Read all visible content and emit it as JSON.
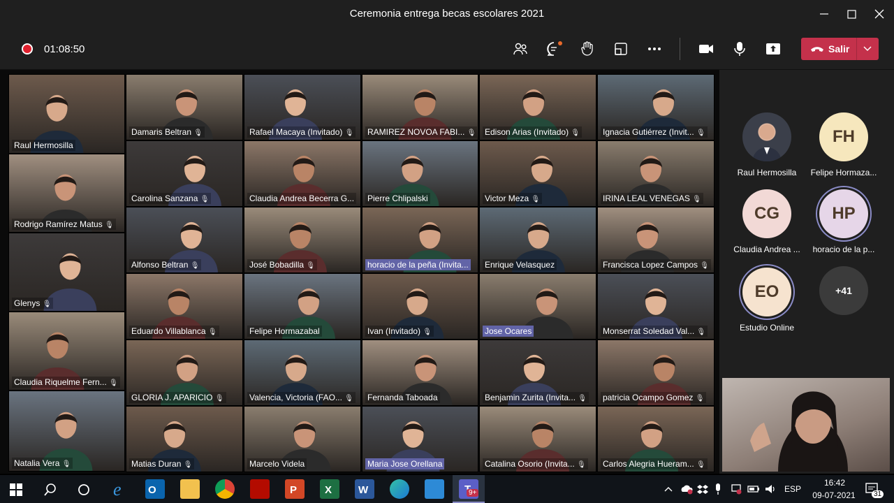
{
  "window": {
    "title": "Ceremonia entrega becas escolares 2021"
  },
  "toolbar": {
    "timer": "01:08:50",
    "leave_label": "Salir",
    "icons": [
      "people-icon",
      "chat-icon",
      "reactions-icon",
      "share-tray-icon",
      "more-icon",
      "camera-icon",
      "mic-icon",
      "share-screen-icon"
    ]
  },
  "grid": {
    "tiles": [
      {
        "name": "Raul Hermosilla",
        "mic": false
      },
      {
        "name": "Damaris Beltran",
        "mic": true
      },
      {
        "name": "Rafael Macaya (Invitado)",
        "mic": true
      },
      {
        "name": "RAMIREZ NOVOA FABI...",
        "mic": true
      },
      {
        "name": "Edison Arias (Invitado)",
        "mic": true
      },
      {
        "name": "Ignacia Gutiérrez (Invit...",
        "mic": true
      },
      {
        "name": "Rodrigo Ramírez Matus",
        "mic": true
      },
      {
        "name": "Carolina Sanzana",
        "mic": true
      },
      {
        "name": "Claudia Andrea Becerra G...",
        "mic": false
      },
      {
        "name": "Pierre Chlipalski",
        "mic": false
      },
      {
        "name": "Victor Meza",
        "mic": true
      },
      {
        "name": "IRINA LEAL VENEGAS",
        "mic": true
      },
      {
        "name": "Alfonso Beltran",
        "mic": true
      },
      {
        "name": "José Bobadilla",
        "mic": true
      },
      {
        "name": "horacio de la peña (Invita...",
        "mic": false
      },
      {
        "name": "Enrique Velasquez",
        "mic": false
      },
      {
        "name": "Francisca Lopez Campos",
        "mic": true
      },
      {
        "name": "Glenys",
        "mic": true
      },
      {
        "name": "Eduardo Villablanca",
        "mic": true
      },
      {
        "name": "Felipe Hormazabal",
        "mic": false
      },
      {
        "name": "Ivan (Invitado)",
        "mic": true
      },
      {
        "name": "Jose Ocares",
        "mic": false
      },
      {
        "name": "Monserrat Soledad Val...",
        "mic": true
      },
      {
        "name": "Claudia Riquelme Fern...",
        "mic": true
      },
      {
        "name": "GLORIA J. APARICIO",
        "mic": true
      },
      {
        "name": "Valencia, Victoria (FAO...",
        "mic": true
      },
      {
        "name": "Fernanda Taboada",
        "mic": false
      },
      {
        "name": "Benjamin Zurita (Invita...",
        "mic": true
      },
      {
        "name": "patricia Ocampo Gomez",
        "mic": true
      },
      {
        "name": "Natalia Vera",
        "mic": true
      },
      {
        "name": "Matias Duran",
        "mic": true
      },
      {
        "name": "Marcelo Videla",
        "mic": false
      },
      {
        "name": "Maria Jose Orellana",
        "mic": false
      },
      {
        "name": "Catalina Osorio (Invita...",
        "mic": true
      },
      {
        "name": "Carlos Alegria Hueram...",
        "mic": true
      }
    ],
    "mic_glyph": "🎙"
  },
  "side": {
    "avatars": [
      {
        "initials": "",
        "name": "Raul Hermosilla"
      },
      {
        "initials": "FH",
        "name": "Felipe Hormaza..."
      },
      {
        "initials": "CG",
        "name": "Claudia Andrea ..."
      },
      {
        "initials": "HP",
        "name": "horacio de la p..."
      },
      {
        "initials": "EO",
        "name": "Estudio Online"
      }
    ],
    "more_count": "+41"
  },
  "taskbar": {
    "lang": "ESP",
    "time": "16:42",
    "date": "09-07-2021",
    "notifications": "31",
    "teams_badge": "9+"
  },
  "colors": {
    "accent": "#6264a7",
    "leave": "#c4314b",
    "bg": "#1f1f1f"
  }
}
